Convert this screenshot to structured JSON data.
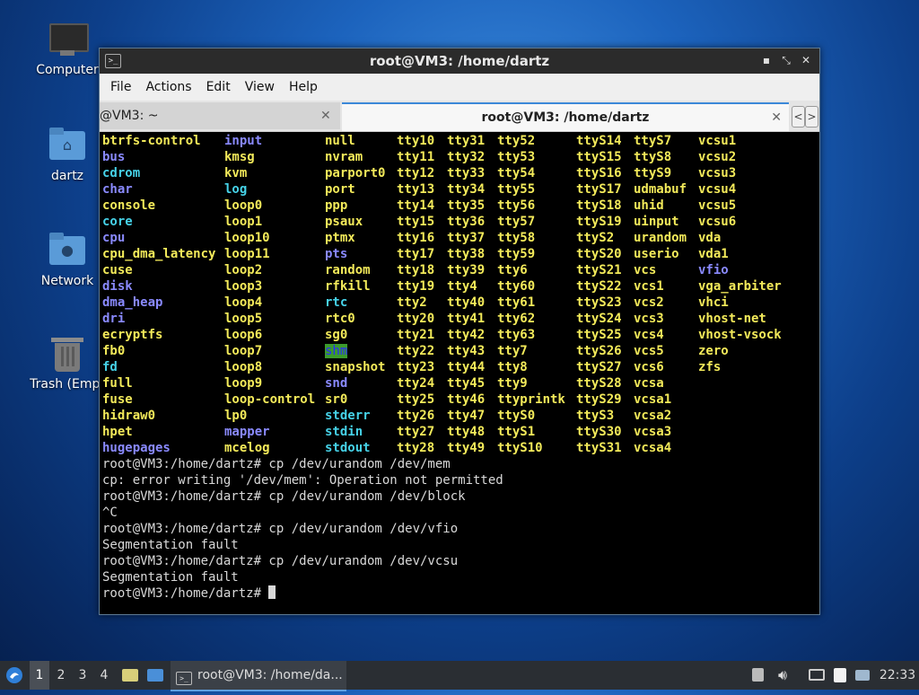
{
  "desktop": {
    "icons": [
      {
        "label": "Computer"
      },
      {
        "label": "dartz"
      },
      {
        "label": "Network"
      },
      {
        "label": "Trash (Empt"
      }
    ]
  },
  "window": {
    "title": "root@VM3: /home/dartz",
    "menu": [
      "File",
      "Actions",
      "Edit",
      "View",
      "Help"
    ],
    "tabs": [
      {
        "label": "@VM3: ~"
      },
      {
        "label": "root@VM3: /home/dartz"
      }
    ]
  },
  "terminal": {
    "columns": [
      [
        [
          "btrfs-control",
          "dev"
        ],
        [
          "bus",
          "dir"
        ],
        [
          "cdrom",
          "link"
        ],
        [
          "char",
          "dir"
        ],
        [
          "console",
          "dev"
        ],
        [
          "core",
          "link"
        ],
        [
          "cpu",
          "dir"
        ],
        [
          "cpu_dma_latency",
          "dev"
        ],
        [
          "cuse",
          "dev"
        ],
        [
          "disk",
          "dir"
        ],
        [
          "dma_heap",
          "dir"
        ],
        [
          "dri",
          "dir"
        ],
        [
          "ecryptfs",
          "dev"
        ],
        [
          "fb0",
          "dev"
        ],
        [
          "fd",
          "link"
        ],
        [
          "full",
          "dev"
        ],
        [
          "fuse",
          "dev"
        ],
        [
          "hidraw0",
          "dev"
        ],
        [
          "hpet",
          "dev"
        ],
        [
          "hugepages",
          "dir"
        ]
      ],
      [
        [
          "input",
          "dir"
        ],
        [
          "kmsg",
          "dev"
        ],
        [
          "kvm",
          "dev"
        ],
        [
          "log",
          "link"
        ],
        [
          "loop0",
          "dev"
        ],
        [
          "loop1",
          "dev"
        ],
        [
          "loop10",
          "dev"
        ],
        [
          "loop11",
          "dev"
        ],
        [
          "loop2",
          "dev"
        ],
        [
          "loop3",
          "dev"
        ],
        [
          "loop4",
          "dev"
        ],
        [
          "loop5",
          "dev"
        ],
        [
          "loop6",
          "dev"
        ],
        [
          "loop7",
          "dev"
        ],
        [
          "loop8",
          "dev"
        ],
        [
          "loop9",
          "dev"
        ],
        [
          "loop-control",
          "dev"
        ],
        [
          "lp0",
          "dev"
        ],
        [
          "mapper",
          "dir"
        ],
        [
          "mcelog",
          "dev"
        ]
      ],
      [
        [
          "null",
          "dev"
        ],
        [
          "nvram",
          "dev"
        ],
        [
          "parport0",
          "dev"
        ],
        [
          "port",
          "dev"
        ],
        [
          "ppp",
          "dev"
        ],
        [
          "psaux",
          "dev"
        ],
        [
          "ptmx",
          "dev"
        ],
        [
          "pts",
          "dir"
        ],
        [
          "random",
          "dev"
        ],
        [
          "rfkill",
          "dev"
        ],
        [
          "rtc",
          "link"
        ],
        [
          "rtc0",
          "dev"
        ],
        [
          "sg0",
          "dev"
        ],
        [
          "shm",
          "hl"
        ],
        [
          "snapshot",
          "dev"
        ],
        [
          "snd",
          "dir"
        ],
        [
          "sr0",
          "dev"
        ],
        [
          "stderr",
          "link"
        ],
        [
          "stdin",
          "link"
        ],
        [
          "stdout",
          "link"
        ]
      ],
      [
        [
          "tty10",
          "dev"
        ],
        [
          "tty11",
          "dev"
        ],
        [
          "tty12",
          "dev"
        ],
        [
          "tty13",
          "dev"
        ],
        [
          "tty14",
          "dev"
        ],
        [
          "tty15",
          "dev"
        ],
        [
          "tty16",
          "dev"
        ],
        [
          "tty17",
          "dev"
        ],
        [
          "tty18",
          "dev"
        ],
        [
          "tty19",
          "dev"
        ],
        [
          "tty2",
          "dev"
        ],
        [
          "tty20",
          "dev"
        ],
        [
          "tty21",
          "dev"
        ],
        [
          "tty22",
          "dev"
        ],
        [
          "tty23",
          "dev"
        ],
        [
          "tty24",
          "dev"
        ],
        [
          "tty25",
          "dev"
        ],
        [
          "tty26",
          "dev"
        ],
        [
          "tty27",
          "dev"
        ],
        [
          "tty28",
          "dev"
        ]
      ],
      [
        [
          "tty31",
          "dev"
        ],
        [
          "tty32",
          "dev"
        ],
        [
          "tty33",
          "dev"
        ],
        [
          "tty34",
          "dev"
        ],
        [
          "tty35",
          "dev"
        ],
        [
          "tty36",
          "dev"
        ],
        [
          "tty37",
          "dev"
        ],
        [
          "tty38",
          "dev"
        ],
        [
          "tty39",
          "dev"
        ],
        [
          "tty4",
          "dev"
        ],
        [
          "tty40",
          "dev"
        ],
        [
          "tty41",
          "dev"
        ],
        [
          "tty42",
          "dev"
        ],
        [
          "tty43",
          "dev"
        ],
        [
          "tty44",
          "dev"
        ],
        [
          "tty45",
          "dev"
        ],
        [
          "tty46",
          "dev"
        ],
        [
          "tty47",
          "dev"
        ],
        [
          "tty48",
          "dev"
        ],
        [
          "tty49",
          "dev"
        ]
      ],
      [
        [
          "tty52",
          "dev"
        ],
        [
          "tty53",
          "dev"
        ],
        [
          "tty54",
          "dev"
        ],
        [
          "tty55",
          "dev"
        ],
        [
          "tty56",
          "dev"
        ],
        [
          "tty57",
          "dev"
        ],
        [
          "tty58",
          "dev"
        ],
        [
          "tty59",
          "dev"
        ],
        [
          "tty6",
          "dev"
        ],
        [
          "tty60",
          "dev"
        ],
        [
          "tty61",
          "dev"
        ],
        [
          "tty62",
          "dev"
        ],
        [
          "tty63",
          "dev"
        ],
        [
          "tty7",
          "dev"
        ],
        [
          "tty8",
          "dev"
        ],
        [
          "tty9",
          "dev"
        ],
        [
          "ttyprintk",
          "dev"
        ],
        [
          "ttyS0",
          "dev"
        ],
        [
          "ttyS1",
          "dev"
        ],
        [
          "ttyS10",
          "dev"
        ]
      ],
      [
        [
          "ttyS14",
          "dev"
        ],
        [
          "ttyS15",
          "dev"
        ],
        [
          "ttyS16",
          "dev"
        ],
        [
          "ttyS17",
          "dev"
        ],
        [
          "ttyS18",
          "dev"
        ],
        [
          "ttyS19",
          "dev"
        ],
        [
          "ttyS2",
          "dev"
        ],
        [
          "ttyS20",
          "dev"
        ],
        [
          "ttyS21",
          "dev"
        ],
        [
          "ttyS22",
          "dev"
        ],
        [
          "ttyS23",
          "dev"
        ],
        [
          "ttyS24",
          "dev"
        ],
        [
          "ttyS25",
          "dev"
        ],
        [
          "ttyS26",
          "dev"
        ],
        [
          "ttyS27",
          "dev"
        ],
        [
          "ttyS28",
          "dev"
        ],
        [
          "ttyS29",
          "dev"
        ],
        [
          "ttyS3",
          "dev"
        ],
        [
          "ttyS30",
          "dev"
        ],
        [
          "ttyS31",
          "dev"
        ]
      ],
      [
        [
          "ttyS7",
          "dev"
        ],
        [
          "ttyS8",
          "dev"
        ],
        [
          "ttyS9",
          "dev"
        ],
        [
          "udmabuf",
          "dev"
        ],
        [
          "uhid",
          "dev"
        ],
        [
          "uinput",
          "dev"
        ],
        [
          "urandom",
          "dev"
        ],
        [
          "userio",
          "dev"
        ],
        [
          "vcs",
          "dev"
        ],
        [
          "vcs1",
          "dev"
        ],
        [
          "vcs2",
          "dev"
        ],
        [
          "vcs3",
          "dev"
        ],
        [
          "vcs4",
          "dev"
        ],
        [
          "vcs5",
          "dev"
        ],
        [
          "vcs6",
          "dev"
        ],
        [
          "vcsa",
          "dev"
        ],
        [
          "vcsa1",
          "dev"
        ],
        [
          "vcsa2",
          "dev"
        ],
        [
          "vcsa3",
          "dev"
        ],
        [
          "vcsa4",
          "dev"
        ]
      ],
      [
        [
          "vcsu1",
          "dev"
        ],
        [
          "vcsu2",
          "dev"
        ],
        [
          "vcsu3",
          "dev"
        ],
        [
          "vcsu4",
          "dev"
        ],
        [
          "vcsu5",
          "dev"
        ],
        [
          "vcsu6",
          "dev"
        ],
        [
          "vda",
          "dev"
        ],
        [
          "vda1",
          "dev"
        ],
        [
          "vfio",
          "dir"
        ],
        [
          "vga_arbiter",
          "dev"
        ],
        [
          "vhci",
          "dev"
        ],
        [
          "vhost-net",
          "dev"
        ],
        [
          "vhost-vsock",
          "dev"
        ],
        [
          "zero",
          "dev"
        ],
        [
          "zfs",
          "dev"
        ]
      ]
    ],
    "output": [
      "root@VM3:/home/dartz# cp /dev/urandom /dev/mem",
      "cp: error writing '/dev/mem': Operation not permitted",
      "root@VM3:/home/dartz# cp /dev/urandom /dev/block",
      "^C",
      "root@VM3:/home/dartz# cp /dev/urandom /dev/vfio",
      "Segmentation fault",
      "root@VM3:/home/dartz# cp /dev/urandom /dev/vcsu",
      "Segmentation fault"
    ],
    "prompt": "root@VM3:/home/dartz# "
  },
  "taskbar": {
    "workspaces": [
      "1",
      "2",
      "3",
      "4"
    ],
    "task_label": "root@VM3: /home/da...",
    "clock": "22:33"
  }
}
